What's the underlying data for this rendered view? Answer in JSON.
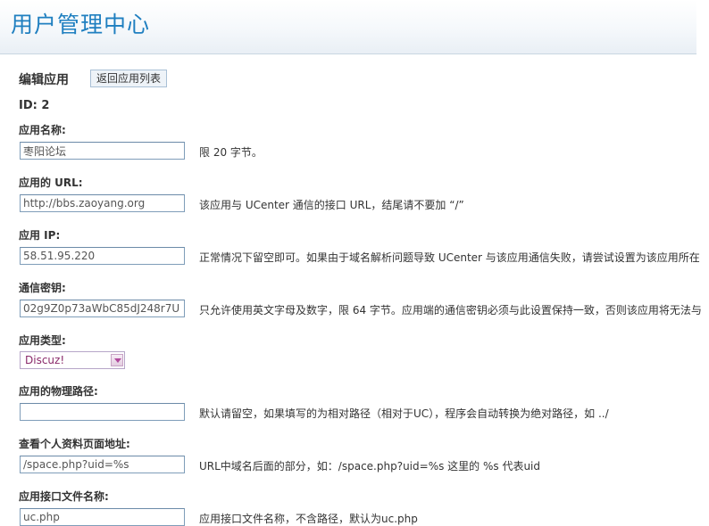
{
  "header": {
    "title": "用户管理中心"
  },
  "page": {
    "title": "编辑应用",
    "back_label": "返回应用列表",
    "id_text": "ID: 2"
  },
  "fields": {
    "name": {
      "label": "应用名称:",
      "value": "枣阳论坛",
      "hint": "限  20 字节。"
    },
    "url": {
      "label": "应用的  URL:",
      "value": "http://bbs.zaoyang.org",
      "hint": "该应用与  UCenter 通信的接口  URL，结尾请不要加 “/”"
    },
    "ip": {
      "label": "应用  IP:",
      "value": "58.51.95.220",
      "hint": "正常情况下留空即可。如果由于域名解析问题导致  UCenter 与该应用通信失败，请尝试设置为该应用所在"
    },
    "authkey": {
      "label": "通信密钥:",
      "value": "02g9Z0p73aWbC85dJ248r7U",
      "hint": "只允许使用英文字母及数字，限  64 字节。应用端的通信密钥必须与此设置保持一致，否则该应用将无法与"
    },
    "type": {
      "label": "应用类型:",
      "value": "Discuz!"
    },
    "path": {
      "label": "应用的物理路径:",
      "value": "",
      "hint": "默认请留空，如果填写的为相对路径（相对于UC），程序会自动转换为绝对路径，如  ../"
    },
    "viewpro": {
      "label": "查看个人资料页面地址:",
      "value": "/space.php?uid=%s",
      "hint": "URL中域名后面的部分，如：/space.php?uid=%s 这里的  %s 代表uid"
    },
    "apifile": {
      "label": "应用接口文件名称:",
      "value": "uc.php",
      "hint": "应用接口文件名称，不含路径，默认为uc.php"
    }
  },
  "colors": {
    "header_title": "#1f7fc0",
    "input_border": "#7f9db9",
    "select_text": "#8a2a6a"
  }
}
